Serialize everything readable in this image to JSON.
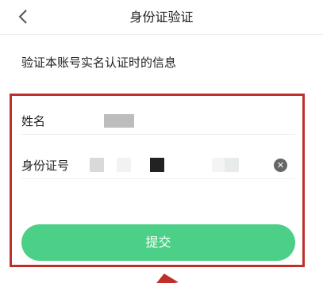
{
  "nav": {
    "title": "身份证验证"
  },
  "subtitle": "验证本账号实名认证时的信息",
  "form": {
    "name_label": "姓名",
    "id_label": "身份证号"
  },
  "submit_label": "提交",
  "colors": {
    "accent_green": "#4ccf86",
    "highlight_red": "#c0302a"
  },
  "icons": {
    "back": "chevron-left-icon",
    "clear": "clear-circle-x-icon"
  }
}
